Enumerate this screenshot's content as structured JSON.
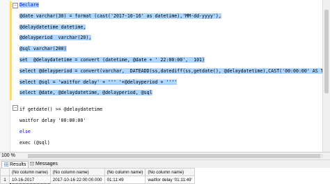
{
  "editor": {
    "lines": [
      {
        "text": "Declare"
      },
      {
        "text": "@date varchar(30) = format (cast('2017-10-16' as datetime),'MM-dd-yyyy'),"
      },
      {
        "text": "@delaydatetime datetime,"
      },
      {
        "text": "@delayperiod  varchar(20),"
      },
      {
        "text": "@sql varchar(200)"
      },
      {
        "text": "set  @delaydatetime = convert (datetime, @date + ' 22:00:00',  101)"
      },
      {
        "text": "select @delayperiod = convert(varchar,  DATEADD(ss,datediff(ss,getdate(), @delaydatetime),CAST('00:00:00' AS TIME)), 108)"
      },
      {
        "text": "select @sql = 'waitfor delay' + ''' '+@delayperiod + ''''"
      },
      {
        "text": "select @date, @delaydatetime, @delayperiod, @sql"
      },
      {
        "text": "if getdate() >= @delaydatetime"
      },
      {
        "text": "waitfor delay '00:00:00'"
      },
      {
        "text": "else"
      },
      {
        "text": "exec (@sql)"
      }
    ]
  },
  "status": {
    "zoom": "100 %"
  },
  "tabs": {
    "results": "Results",
    "messages": "Messages"
  },
  "grid": {
    "headers": [
      "(No column name)",
      "(No column name)",
      "(No column name)",
      "(No column name)"
    ],
    "rows": [
      {
        "num": "1",
        "cells": [
          "10-16-2017",
          "2017-10-16 22:00:00.000",
          "01:11:49",
          "waitfor delay '01:11:49'"
        ]
      }
    ]
  }
}
